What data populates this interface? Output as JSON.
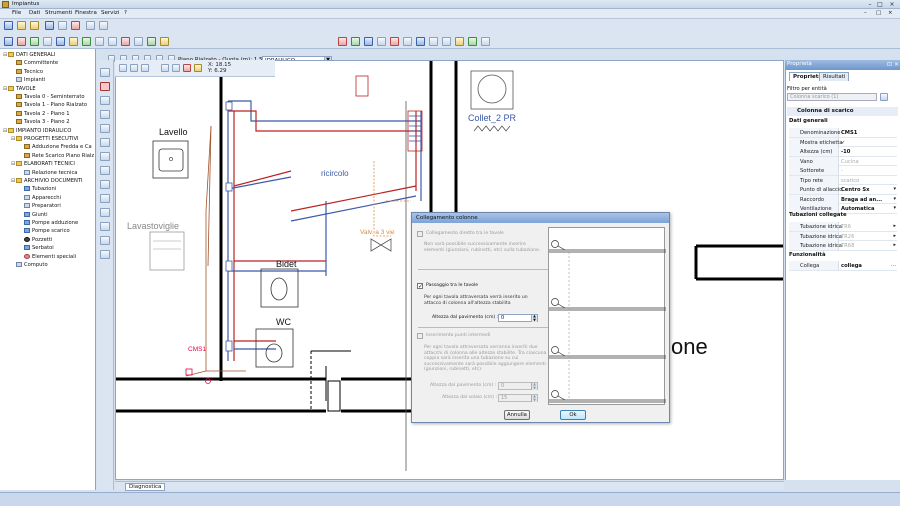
{
  "window": {
    "title": "Impiantus"
  },
  "menu": [
    "File",
    "Dati",
    "Strumenti",
    "Finestra",
    "Servizi",
    "?"
  ],
  "toolbar": {
    "plan_label": "Piano Rialzato - Quota (m): 1.50",
    "layer_value": "IDRAULICO"
  },
  "coords": {
    "x": "X: 18.15",
    "y": "Y: 6.29"
  },
  "tree": {
    "items": [
      {
        "label": "DATI GENERALI",
        "level": 0,
        "icon": "folder"
      },
      {
        "label": "Committente",
        "level": 1,
        "icon": "person"
      },
      {
        "label": "Tecnico",
        "level": 1,
        "icon": "person"
      },
      {
        "label": "Impianti",
        "level": 1,
        "icon": "document"
      },
      {
        "label": "TAVOLE",
        "level": 0,
        "icon": "folder"
      },
      {
        "label": "Tavola 0 - Seminterrato",
        "level": 1,
        "icon": "drawing"
      },
      {
        "label": "Tavola 1 - Piano Rialzato",
        "level": 1,
        "icon": "drawing"
      },
      {
        "label": "Tavola 2 - Piano 1",
        "level": 1,
        "icon": "drawing"
      },
      {
        "label": "Tavola 3 - Piano 2",
        "level": 1,
        "icon": "drawing"
      },
      {
        "label": "IMPIANTO IDRAULICO",
        "level": 0,
        "icon": "folder"
      },
      {
        "label": "PROGETTI ESECUTIVI",
        "level": 1,
        "icon": "folder"
      },
      {
        "label": "Adduzione Fredda e Ca",
        "level": 2,
        "icon": "drawing"
      },
      {
        "label": "Rete Scarico Piano Rialz",
        "level": 2,
        "icon": "drawing"
      },
      {
        "label": "ELABORATI TECNICI",
        "level": 1,
        "icon": "folder"
      },
      {
        "label": "Relazione tecnica",
        "level": 2,
        "icon": "document"
      },
      {
        "label": "ARCHIVIO DOCUMENTI",
        "level": 1,
        "icon": "folder"
      },
      {
        "label": "Tubazioni",
        "level": 2,
        "icon": "pipe"
      },
      {
        "label": "Apparecchi",
        "level": 2,
        "icon": "fixture"
      },
      {
        "label": "Preparatori",
        "level": 2,
        "icon": "fixture"
      },
      {
        "label": "Giunti",
        "level": 2,
        "icon": "fitting"
      },
      {
        "label": "Pompe adduzione",
        "level": 2,
        "icon": "pump"
      },
      {
        "label": "Pompe scarico",
        "level": 2,
        "icon": "pump"
      },
      {
        "label": "Pozzetti",
        "level": 2,
        "icon": "manhole"
      },
      {
        "label": "Serbatoi",
        "level": 2,
        "icon": "tank"
      },
      {
        "label": "Elementi speciali",
        "level": 2,
        "icon": "special"
      },
      {
        "label": "Computo",
        "level": 1,
        "icon": "document"
      }
    ]
  },
  "drawing": {
    "labels": {
      "lavello": "Lavello",
      "lavastoviglie": "Lavastoviglie",
      "bidet": "Bidet",
      "wc": "WC",
      "ricircolo": "ricircolo",
      "valv": "Valv. a 3 vie",
      "collettore": "Collet_2 PR",
      "cms": "CMS1",
      "stanza": "one"
    }
  },
  "dialog": {
    "title": "Collegamento colonne",
    "opt1": {
      "label": "Collegamento diretto tra le tavole",
      "checked": false,
      "enabled": false,
      "desc": "Non sarà possibile successivamente inserire elementi (giunzioni, rubinetti, etc) sulla tubazione."
    },
    "opt2": {
      "label": "Passaggio tra le tavole",
      "checked": true,
      "enabled": true,
      "desc": "Per ogni tavola attraversata verrà inserito un attacco di colonna all'altezza stabilita",
      "height_label": "Altezza dal pavimento (cm) :",
      "height_value": "0"
    },
    "opt3": {
      "label": "Inserimento punti intermedi",
      "checked": false,
      "enabled": false,
      "desc": "Per ogni tavola attraversata verranno inseriti due attacchi di colonna alle altezze stabilite. Tra ciascuna coppia sarà inserita una tubazione su cui successivamente sarà possibile aggiungere elementi (giunzioni, rubinetti, etc).",
      "floor_label": "Altezza dal pavimento (cm) :",
      "floor_value": "0",
      "ceiling_label": "Altezza dal solaio (cm) :",
      "ceiling_value": "15"
    },
    "cancel_label": "Annulla",
    "ok_label": "Ok"
  },
  "properties": {
    "header": "Proprietà",
    "tabs": [
      "Proprietà",
      "Risultati"
    ],
    "filter_label": "Filtro per entità",
    "filter_value": "Colonna scarico (1)",
    "entity_title": "Colonna di scarico",
    "sections": {
      "general": "Dati generali",
      "pipes": "Tubazioni collegate",
      "func": "Funzionalità"
    },
    "rows": [
      {
        "k": "Denominazione",
        "v": "CMS1",
        "dim": false
      },
      {
        "k": "Mostra etichetta",
        "v": "✓",
        "dim": false
      },
      {
        "k": "Altezza (cm)",
        "v": "-10",
        "dim": false
      },
      {
        "k": "Vano",
        "v": "Cucina",
        "dim": true
      },
      {
        "k": "Sottorete",
        "v": "-",
        "dim": true
      },
      {
        "k": "Tipo rete",
        "v": "scarico",
        "dim": true
      },
      {
        "k": "Punto di allaccio",
        "v": "Centro Sx",
        "dim": false
      },
      {
        "k": "Raccordo",
        "v": "Braga ad an...",
        "dim": false
      },
      {
        "k": "Ventilazione",
        "v": "Automatica",
        "dim": false
      }
    ],
    "pipe_rows": [
      {
        "k": "Tubazione idrica",
        "v": "TR6"
      },
      {
        "k": "Tubazione idrica",
        "v": "TR26"
      },
      {
        "k": "Tubazione idrica",
        "v": "TR68"
      }
    ],
    "func_row": {
      "k": "Collega",
      "v": "collega"
    }
  },
  "bottom": {
    "tab_label": "Diagnostica"
  }
}
